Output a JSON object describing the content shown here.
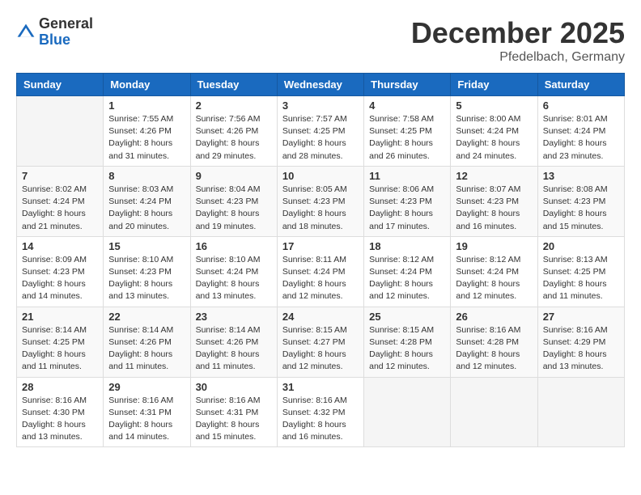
{
  "header": {
    "logo": {
      "general": "General",
      "blue": "Blue"
    },
    "title": "December 2025",
    "location": "Pfedelbach, Germany"
  },
  "calendar": {
    "weekdays": [
      "Sunday",
      "Monday",
      "Tuesday",
      "Wednesday",
      "Thursday",
      "Friday",
      "Saturday"
    ],
    "weeks": [
      [
        {
          "day": "",
          "info": ""
        },
        {
          "day": "1",
          "info": "Sunrise: 7:55 AM\nSunset: 4:26 PM\nDaylight: 8 hours\nand 31 minutes."
        },
        {
          "day": "2",
          "info": "Sunrise: 7:56 AM\nSunset: 4:26 PM\nDaylight: 8 hours\nand 29 minutes."
        },
        {
          "day": "3",
          "info": "Sunrise: 7:57 AM\nSunset: 4:25 PM\nDaylight: 8 hours\nand 28 minutes."
        },
        {
          "day": "4",
          "info": "Sunrise: 7:58 AM\nSunset: 4:25 PM\nDaylight: 8 hours\nand 26 minutes."
        },
        {
          "day": "5",
          "info": "Sunrise: 8:00 AM\nSunset: 4:24 PM\nDaylight: 8 hours\nand 24 minutes."
        },
        {
          "day": "6",
          "info": "Sunrise: 8:01 AM\nSunset: 4:24 PM\nDaylight: 8 hours\nand 23 minutes."
        }
      ],
      [
        {
          "day": "7",
          "info": "Sunrise: 8:02 AM\nSunset: 4:24 PM\nDaylight: 8 hours\nand 21 minutes."
        },
        {
          "day": "8",
          "info": "Sunrise: 8:03 AM\nSunset: 4:24 PM\nDaylight: 8 hours\nand 20 minutes."
        },
        {
          "day": "9",
          "info": "Sunrise: 8:04 AM\nSunset: 4:23 PM\nDaylight: 8 hours\nand 19 minutes."
        },
        {
          "day": "10",
          "info": "Sunrise: 8:05 AM\nSunset: 4:23 PM\nDaylight: 8 hours\nand 18 minutes."
        },
        {
          "day": "11",
          "info": "Sunrise: 8:06 AM\nSunset: 4:23 PM\nDaylight: 8 hours\nand 17 minutes."
        },
        {
          "day": "12",
          "info": "Sunrise: 8:07 AM\nSunset: 4:23 PM\nDaylight: 8 hours\nand 16 minutes."
        },
        {
          "day": "13",
          "info": "Sunrise: 8:08 AM\nSunset: 4:23 PM\nDaylight: 8 hours\nand 15 minutes."
        }
      ],
      [
        {
          "day": "14",
          "info": "Sunrise: 8:09 AM\nSunset: 4:23 PM\nDaylight: 8 hours\nand 14 minutes."
        },
        {
          "day": "15",
          "info": "Sunrise: 8:10 AM\nSunset: 4:23 PM\nDaylight: 8 hours\nand 13 minutes."
        },
        {
          "day": "16",
          "info": "Sunrise: 8:10 AM\nSunset: 4:24 PM\nDaylight: 8 hours\nand 13 minutes."
        },
        {
          "day": "17",
          "info": "Sunrise: 8:11 AM\nSunset: 4:24 PM\nDaylight: 8 hours\nand 12 minutes."
        },
        {
          "day": "18",
          "info": "Sunrise: 8:12 AM\nSunset: 4:24 PM\nDaylight: 8 hours\nand 12 minutes."
        },
        {
          "day": "19",
          "info": "Sunrise: 8:12 AM\nSunset: 4:24 PM\nDaylight: 8 hours\nand 12 minutes."
        },
        {
          "day": "20",
          "info": "Sunrise: 8:13 AM\nSunset: 4:25 PM\nDaylight: 8 hours\nand 11 minutes."
        }
      ],
      [
        {
          "day": "21",
          "info": "Sunrise: 8:14 AM\nSunset: 4:25 PM\nDaylight: 8 hours\nand 11 minutes."
        },
        {
          "day": "22",
          "info": "Sunrise: 8:14 AM\nSunset: 4:26 PM\nDaylight: 8 hours\nand 11 minutes."
        },
        {
          "day": "23",
          "info": "Sunrise: 8:14 AM\nSunset: 4:26 PM\nDaylight: 8 hours\nand 11 minutes."
        },
        {
          "day": "24",
          "info": "Sunrise: 8:15 AM\nSunset: 4:27 PM\nDaylight: 8 hours\nand 12 minutes."
        },
        {
          "day": "25",
          "info": "Sunrise: 8:15 AM\nSunset: 4:28 PM\nDaylight: 8 hours\nand 12 minutes."
        },
        {
          "day": "26",
          "info": "Sunrise: 8:16 AM\nSunset: 4:28 PM\nDaylight: 8 hours\nand 12 minutes."
        },
        {
          "day": "27",
          "info": "Sunrise: 8:16 AM\nSunset: 4:29 PM\nDaylight: 8 hours\nand 13 minutes."
        }
      ],
      [
        {
          "day": "28",
          "info": "Sunrise: 8:16 AM\nSunset: 4:30 PM\nDaylight: 8 hours\nand 13 minutes."
        },
        {
          "day": "29",
          "info": "Sunrise: 8:16 AM\nSunset: 4:31 PM\nDaylight: 8 hours\nand 14 minutes."
        },
        {
          "day": "30",
          "info": "Sunrise: 8:16 AM\nSunset: 4:31 PM\nDaylight: 8 hours\nand 15 minutes."
        },
        {
          "day": "31",
          "info": "Sunrise: 8:16 AM\nSunset: 4:32 PM\nDaylight: 8 hours\nand 16 minutes."
        },
        {
          "day": "",
          "info": ""
        },
        {
          "day": "",
          "info": ""
        },
        {
          "day": "",
          "info": ""
        }
      ]
    ]
  }
}
